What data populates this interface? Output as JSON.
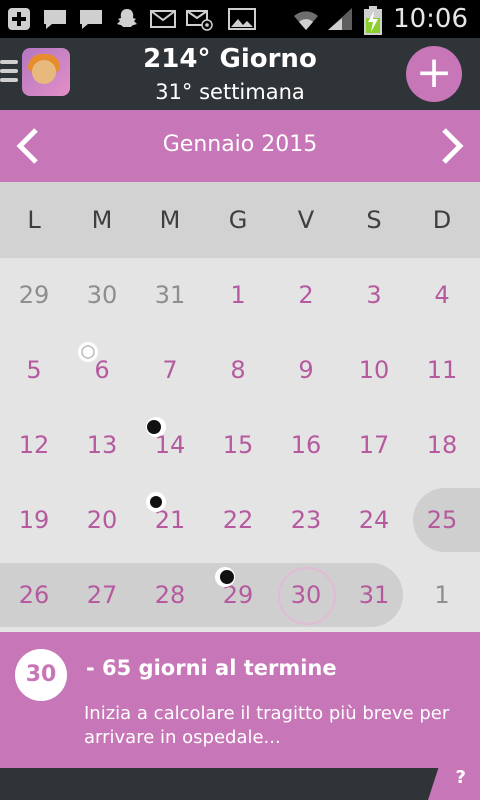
{
  "status_bar": {
    "time": "10:06",
    "icons": [
      "add-icon",
      "message-icon",
      "message-icon",
      "snapchat-icon",
      "mail-icon",
      "mail-at-icon",
      "image-icon",
      "wifi-icon",
      "signal-icon",
      "battery-charging-icon"
    ]
  },
  "header": {
    "day_label": "214° Giorno",
    "week_label": "31° settimana",
    "add_label": "+"
  },
  "calendar": {
    "month_label": "Gennaio 2015",
    "prev_icon": "chevron-left-icon",
    "next_icon": "chevron-right-icon",
    "weekdays": [
      "L",
      "M",
      "M",
      "G",
      "V",
      "S",
      "D"
    ],
    "weeks": [
      [
        "29",
        "30",
        "31",
        "1",
        "2",
        "3",
        "4"
      ],
      [
        "5",
        "6",
        "7",
        "8",
        "9",
        "10",
        "11"
      ],
      [
        "12",
        "13",
        "14",
        "15",
        "16",
        "17",
        "18"
      ],
      [
        "19",
        "20",
        "21",
        "22",
        "23",
        "24",
        "25"
      ],
      [
        "26",
        "27",
        "28",
        "29",
        "30",
        "31",
        "1"
      ]
    ],
    "today": "30",
    "moon_phases": [
      {
        "date": "6",
        "phase": "full-moon-icon"
      },
      {
        "date": "14",
        "phase": "last-quarter-icon"
      },
      {
        "date": "21",
        "phase": "new-moon-icon"
      },
      {
        "date": "29",
        "phase": "first-quarter-icon"
      }
    ]
  },
  "info": {
    "badge": "30",
    "title": "- 65 giorni al termine",
    "text": "Inizia a calcolare il tragitto più breve per arrivare in ospedale..."
  },
  "help_label": "?",
  "colors": {
    "accent": "#c776b7",
    "day_text": "#b65aa0",
    "other_text": "#8e8e8e",
    "header_bg": "#2f3439"
  }
}
